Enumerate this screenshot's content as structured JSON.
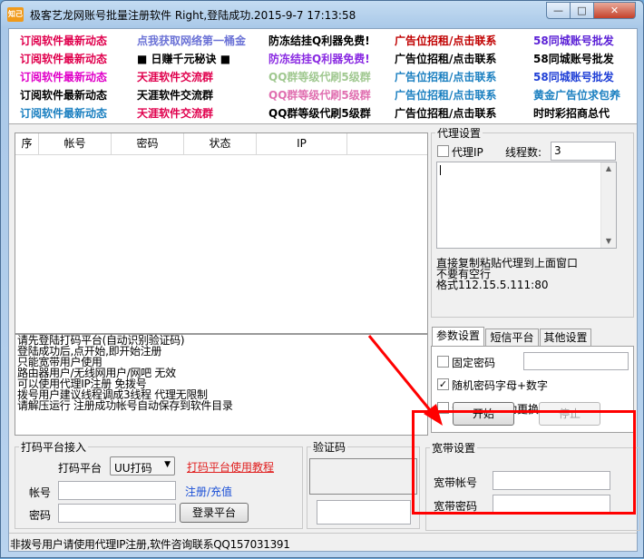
{
  "window": {
    "app_icon": "知己",
    "title": "极客艺龙网账号批量注册软件    Right,登陆成功.2015-9-7 17:13:58",
    "min_symbol": "—",
    "max_symbol": "□",
    "close_symbol": "✕"
  },
  "ads": {
    "rows": [
      [
        {
          "text": "订阅软件最新动态",
          "color": "#e0004d"
        },
        {
          "text": "点我获取网络第一桶金",
          "color": "#6b72d6"
        },
        {
          "text": "防冻结挂Q利器免费!",
          "color": "#000000"
        },
        {
          "text": "广告位招租/点击联系",
          "color": "#c00000"
        },
        {
          "text": "58同城账号批发",
          "color": "#5a1fd6"
        }
      ],
      [
        {
          "text": "订阅软件最新动态",
          "color": "#e0004d"
        },
        {
          "text": "■ 日赚千元秘诀 ■",
          "color": "#000000"
        },
        {
          "text": "防冻结挂Q利器免费!",
          "color": "#8a2be2"
        },
        {
          "text": "广告位招租/点击联系",
          "color": "#000000"
        },
        {
          "text": "58同城账号批发",
          "color": "#000000"
        }
      ],
      [
        {
          "text": "订阅软件最新动态",
          "color": "#e000c8"
        },
        {
          "text": "天涯软件交流群",
          "color": "#e0004d"
        },
        {
          "text": "QQ群等级代刷5级群",
          "color": "#a0c890"
        },
        {
          "text": "广告位招租/点击联系",
          "color": "#1a7fc0"
        },
        {
          "text": "58同城账号批发",
          "color": "#1f3fd6"
        }
      ],
      [
        {
          "text": "订阅软件最新动态",
          "color": "#000000"
        },
        {
          "text": "天涯软件交流群",
          "color": "#000000"
        },
        {
          "text": "QQ群等级代刷5级群",
          "color": "#e06fb0"
        },
        {
          "text": "广告位招租/点击联系",
          "color": "#1a7fc0"
        },
        {
          "text": "黄金广告位求包养",
          "color": "#1a7fc0"
        }
      ],
      [
        {
          "text": "订阅软件最新动态",
          "color": "#1a7fc0"
        },
        {
          "text": "天涯软件交流群",
          "color": "#e0004d"
        },
        {
          "text": "QQ群等级代刷5级群",
          "color": "#000000"
        },
        {
          "text": "广告位招租/点击联系",
          "color": "#000000"
        },
        {
          "text": "时时彩招商总代",
          "color": "#000000"
        }
      ]
    ]
  },
  "grid": {
    "columns": [
      "序",
      "帐号",
      "密码",
      "状态",
      "IP"
    ]
  },
  "log": {
    "lines": [
      "请先登陆打码平台(自动识别验证码)",
      "登陆成功后,点开始,即开始注册",
      "只能宽带用户使用",
      "路由器用户/无线网用户/网吧 无效",
      "可以使用代理IP注册 免拨号",
      "拨号用户建议线程调成3线程 代理无限制",
      "请解压运行 注册成功帐号自动保存到软件目录"
    ]
  },
  "proxy": {
    "legend": "代理设置",
    "proxy_ip_label": "代理IP",
    "threads_label": "线程数:",
    "threads_value": "3",
    "hint": [
      "直接复制粘贴代理到上面窗口",
      "不要有空行",
      "格式112.15.5.111:80"
    ]
  },
  "tabs": {
    "items": [
      "参数设置",
      "短信平台",
      "其他设置"
    ],
    "fixed_password_label": "固定密码",
    "random_password_label": "随机密码字母+数字",
    "auto_ip_label": "注册频繁自动更换IP",
    "start_label": "开始",
    "stop_label": "停止"
  },
  "broadband": {
    "legend": "宽带设置",
    "account_label": "宽带帐号",
    "password_label": "宽带密码"
  },
  "captcha_platform": {
    "legend": "打码平台接入",
    "platform_label": "打码平台",
    "platform_value": "UU打码",
    "tutorial_link": "打码平台使用教程",
    "account_label": "帐号",
    "register_link": "注册/充值",
    "password_label": "密码",
    "login_label": "登录平台"
  },
  "captcha": {
    "legend": "验证码"
  },
  "status": {
    "text": "非拨号用户请使用代理IP注册,软件咨询联系QQ157031391"
  },
  "annotation": {
    "highlight_color": "#ff0000",
    "arrow_color": "#ff0000"
  }
}
